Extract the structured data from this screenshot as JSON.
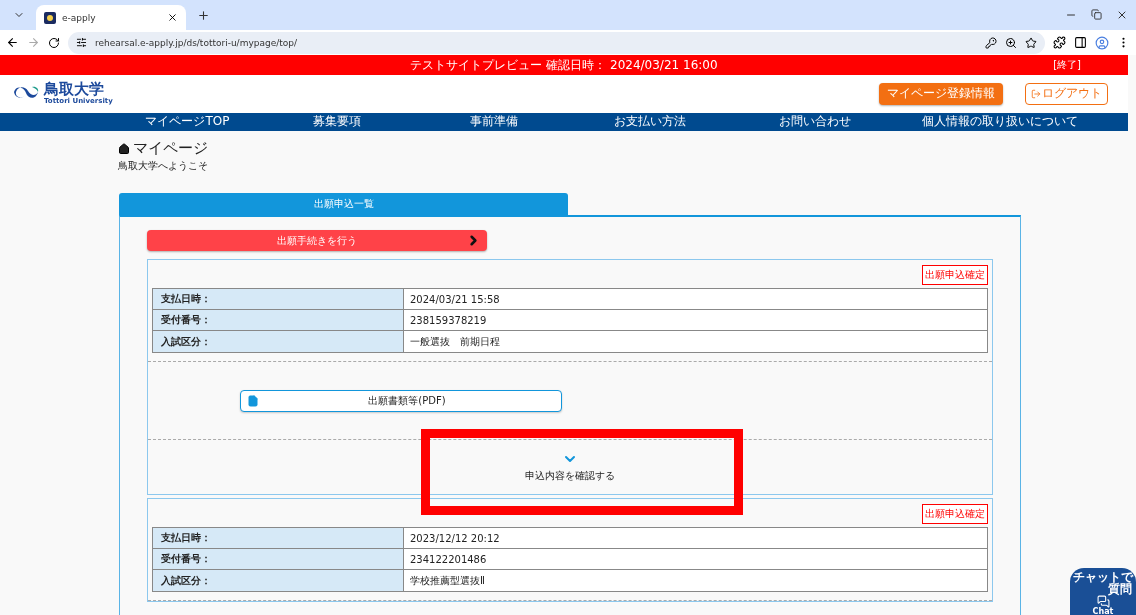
{
  "browser": {
    "tab_title": "e-apply",
    "url": "rehearsal.e-apply.jp/ds/tottori-u/mypage/top/"
  },
  "banner": {
    "text": "テストサイトプレビュー 確認日時： 2024/03/21 16:00",
    "end_link": "[終了]"
  },
  "header": {
    "logo_name": "鳥取大学",
    "logo_sub": "Tottori University",
    "account_button": "マイページ登録情報",
    "logout_button": "ログアウト"
  },
  "nav": [
    "マイページTOP",
    "募集要項",
    "事前準備",
    "お支払い方法",
    "お問い合わせ",
    "個人情報の取り扱いについて"
  ],
  "page": {
    "title": "マイページ",
    "welcome": "鳥取大学へようこそ"
  },
  "tabs": [
    {
      "label": "出願申込一覧",
      "selected": true
    }
  ],
  "action_button": "出願手続きを行う",
  "applications": [
    {
      "status": "出願申込確定",
      "rows": [
        {
          "label": "支払日時：",
          "value": "2024/03/21 15:58"
        },
        {
          "label": "受付番号：",
          "value": "238159378219"
        },
        {
          "label": "入試区分：",
          "value": "一般選抜　前期日程"
        }
      ],
      "document_button": "出願書類等(PDF)",
      "toggle": "申込内容を確認する",
      "expanded": false
    },
    {
      "status": "出願申込確定",
      "rows": [
        {
          "label": "支払日時：",
          "value": "2023/12/12 20:12"
        },
        {
          "label": "受付番号：",
          "value": "234122201486"
        },
        {
          "label": "入試区分：",
          "value": "学校推薦型選抜Ⅱ"
        }
      ]
    }
  ],
  "annotations": [
    {
      "kind": "frame"
    }
  ],
  "chat_widget": {
    "jp_lines": [
      "チャットで",
      "質問"
    ],
    "en_lines": [
      "Chat"
    ]
  }
}
